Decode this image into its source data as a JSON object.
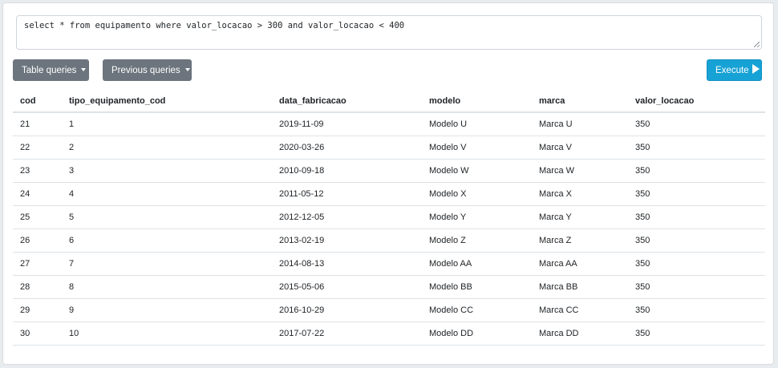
{
  "query": {
    "text": "select * from equipamento where valor_locacao > 300 and valor_locacao < 400"
  },
  "toolbar": {
    "table_queries_label": "Table queries",
    "previous_queries_label": "Previous queries",
    "execute_label": "Execute"
  },
  "colors": {
    "secondary_button": "#6c757d",
    "execute_button": "#17a2d6"
  },
  "icons": {
    "dropdown": "caret-down-icon",
    "execute": "play-icon"
  },
  "results": {
    "columns": [
      "cod",
      "tipo_equipamento_cod",
      "data_fabricacao",
      "modelo",
      "marca",
      "valor_locacao"
    ],
    "rows": [
      [
        "21",
        "1",
        "2019-11-09",
        "Modelo U",
        "Marca U",
        "350"
      ],
      [
        "22",
        "2",
        "2020-03-26",
        "Modelo V",
        "Marca V",
        "350"
      ],
      [
        "23",
        "3",
        "2010-09-18",
        "Modelo W",
        "Marca W",
        "350"
      ],
      [
        "24",
        "4",
        "2011-05-12",
        "Modelo X",
        "Marca X",
        "350"
      ],
      [
        "25",
        "5",
        "2012-12-05",
        "Modelo Y",
        "Marca Y",
        "350"
      ],
      [
        "26",
        "6",
        "2013-02-19",
        "Modelo Z",
        "Marca Z",
        "350"
      ],
      [
        "27",
        "7",
        "2014-08-13",
        "Modelo AA",
        "Marca AA",
        "350"
      ],
      [
        "28",
        "8",
        "2015-05-06",
        "Modelo BB",
        "Marca BB",
        "350"
      ],
      [
        "29",
        "9",
        "2016-10-29",
        "Modelo CC",
        "Marca CC",
        "350"
      ],
      [
        "30",
        "10",
        "2017-07-22",
        "Modelo DD",
        "Marca DD",
        "350"
      ]
    ]
  }
}
